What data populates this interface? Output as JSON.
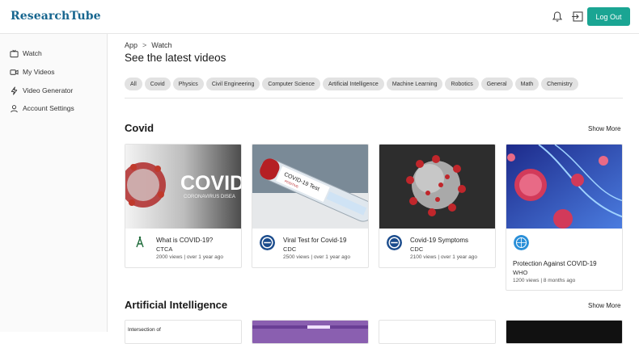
{
  "app": {
    "brand": "ResearchTube",
    "logout_label": "Log Out"
  },
  "sidebar": {
    "items": [
      {
        "label": "Watch",
        "icon": "tv-icon"
      },
      {
        "label": "My Videos",
        "icon": "video-camera-icon"
      },
      {
        "label": "Video Generator",
        "icon": "lightning-icon"
      },
      {
        "label": "Account Settings",
        "icon": "user-icon"
      }
    ]
  },
  "breadcrumb": {
    "root": "App",
    "separator": ">",
    "current": "Watch"
  },
  "page": {
    "title": "See the latest videos"
  },
  "filters": [
    "All",
    "Covid",
    "Physics",
    "Civil Engineering",
    "Computer Science",
    "Artificial Intelligence",
    "Machine Learning",
    "Robotics",
    "General",
    "Math",
    "Chemistry"
  ],
  "sections": [
    {
      "title": "Covid",
      "show_more": "Show More",
      "videos": [
        {
          "title": "What is COVID-19?",
          "channel": "CTCA",
          "meta": "2000 views | over 1 year ago",
          "thumb_text": "COVID",
          "thumb_sub": "CORONAVIRUS DISEA"
        },
        {
          "title": "Viral Test for Covid-19",
          "channel": "CDC",
          "meta": "2500 views | over 1 year ago",
          "thumb_text": "COVID-19 Test",
          "thumb_sub": "POSITIVE"
        },
        {
          "title": "Covid-19 Symptoms",
          "channel": "CDC",
          "meta": "2100 views | over 1 year ago"
        },
        {
          "title": "Protection Against COVID-19",
          "channel": "WHO",
          "meta": "1200 views | 8 months ago"
        }
      ]
    },
    {
      "title": "Artificial Intelligence",
      "show_more": "Show More",
      "videos": [
        {
          "title": "Intersection of"
        },
        {
          "title": ""
        },
        {
          "title": ""
        },
        {
          "title": ""
        }
      ]
    }
  ],
  "colors": {
    "brand": "#17668f",
    "accent": "#1aa593",
    "chip": "#e2e2e2"
  }
}
